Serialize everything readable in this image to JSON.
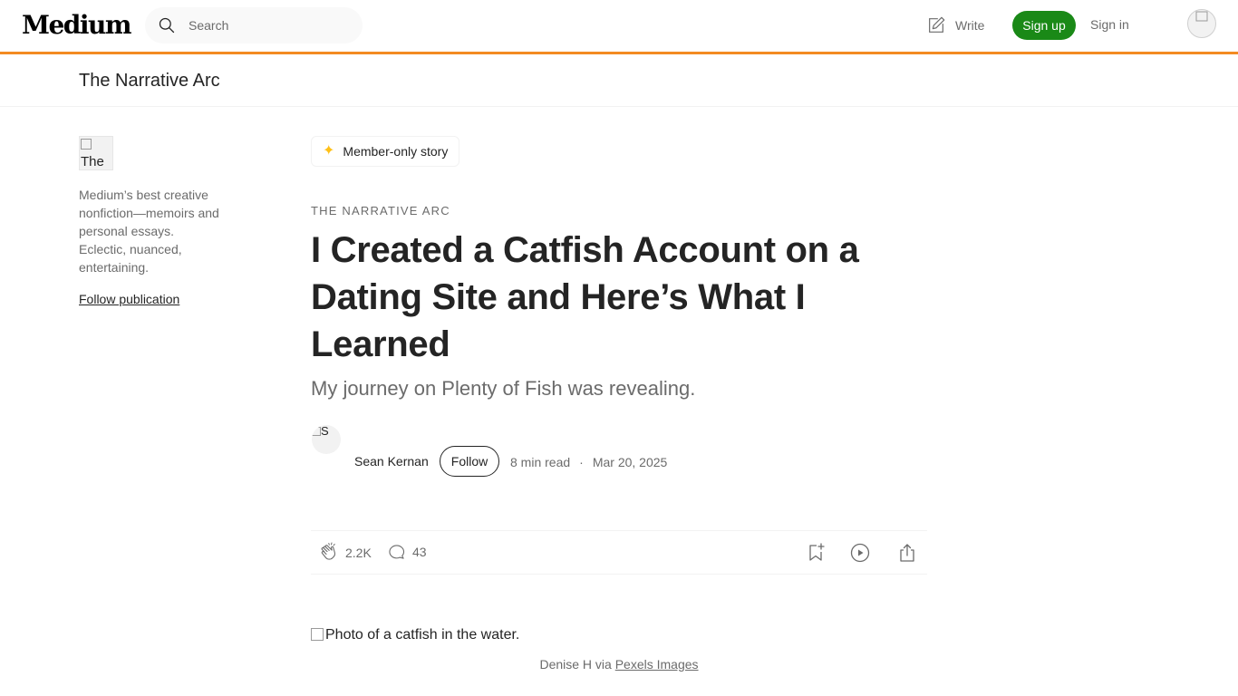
{
  "header": {
    "logo": "Medium",
    "search_placeholder": "Search",
    "write_label": "Write",
    "signup_label": "Sign up",
    "signin_label": "Sign in"
  },
  "publication": {
    "name": "The Narrative Arc",
    "logo_alt": "The",
    "description": "Medium’s best creative nonfiction—memoirs and personal essays. Eclectic, nuanced, entertaining.",
    "follow_label": "Follow publication"
  },
  "article": {
    "member_badge": "Member-only story",
    "kicker": "THE NARRATIVE ARC",
    "title": "I Created a Catfish Account on a Dating Site and Here’s What I Learned",
    "subtitle": "My journey on Plenty of Fish was revealing.",
    "author_avatar_alt": "S",
    "author": "Sean Kernan",
    "follow_label": "Follow",
    "read_time": "8 min read",
    "separator": "·",
    "date": "Mar 20, 2025",
    "claps": "2.2K",
    "responses": "43",
    "image_alt": "Photo of a catfish in the water.",
    "caption_prefix": "Denise H via ",
    "caption_link": "Pexels Images"
  },
  "colors": {
    "accent_line": "#f38b22",
    "signup_green": "#1a8917",
    "member_star": "#ffc017"
  }
}
